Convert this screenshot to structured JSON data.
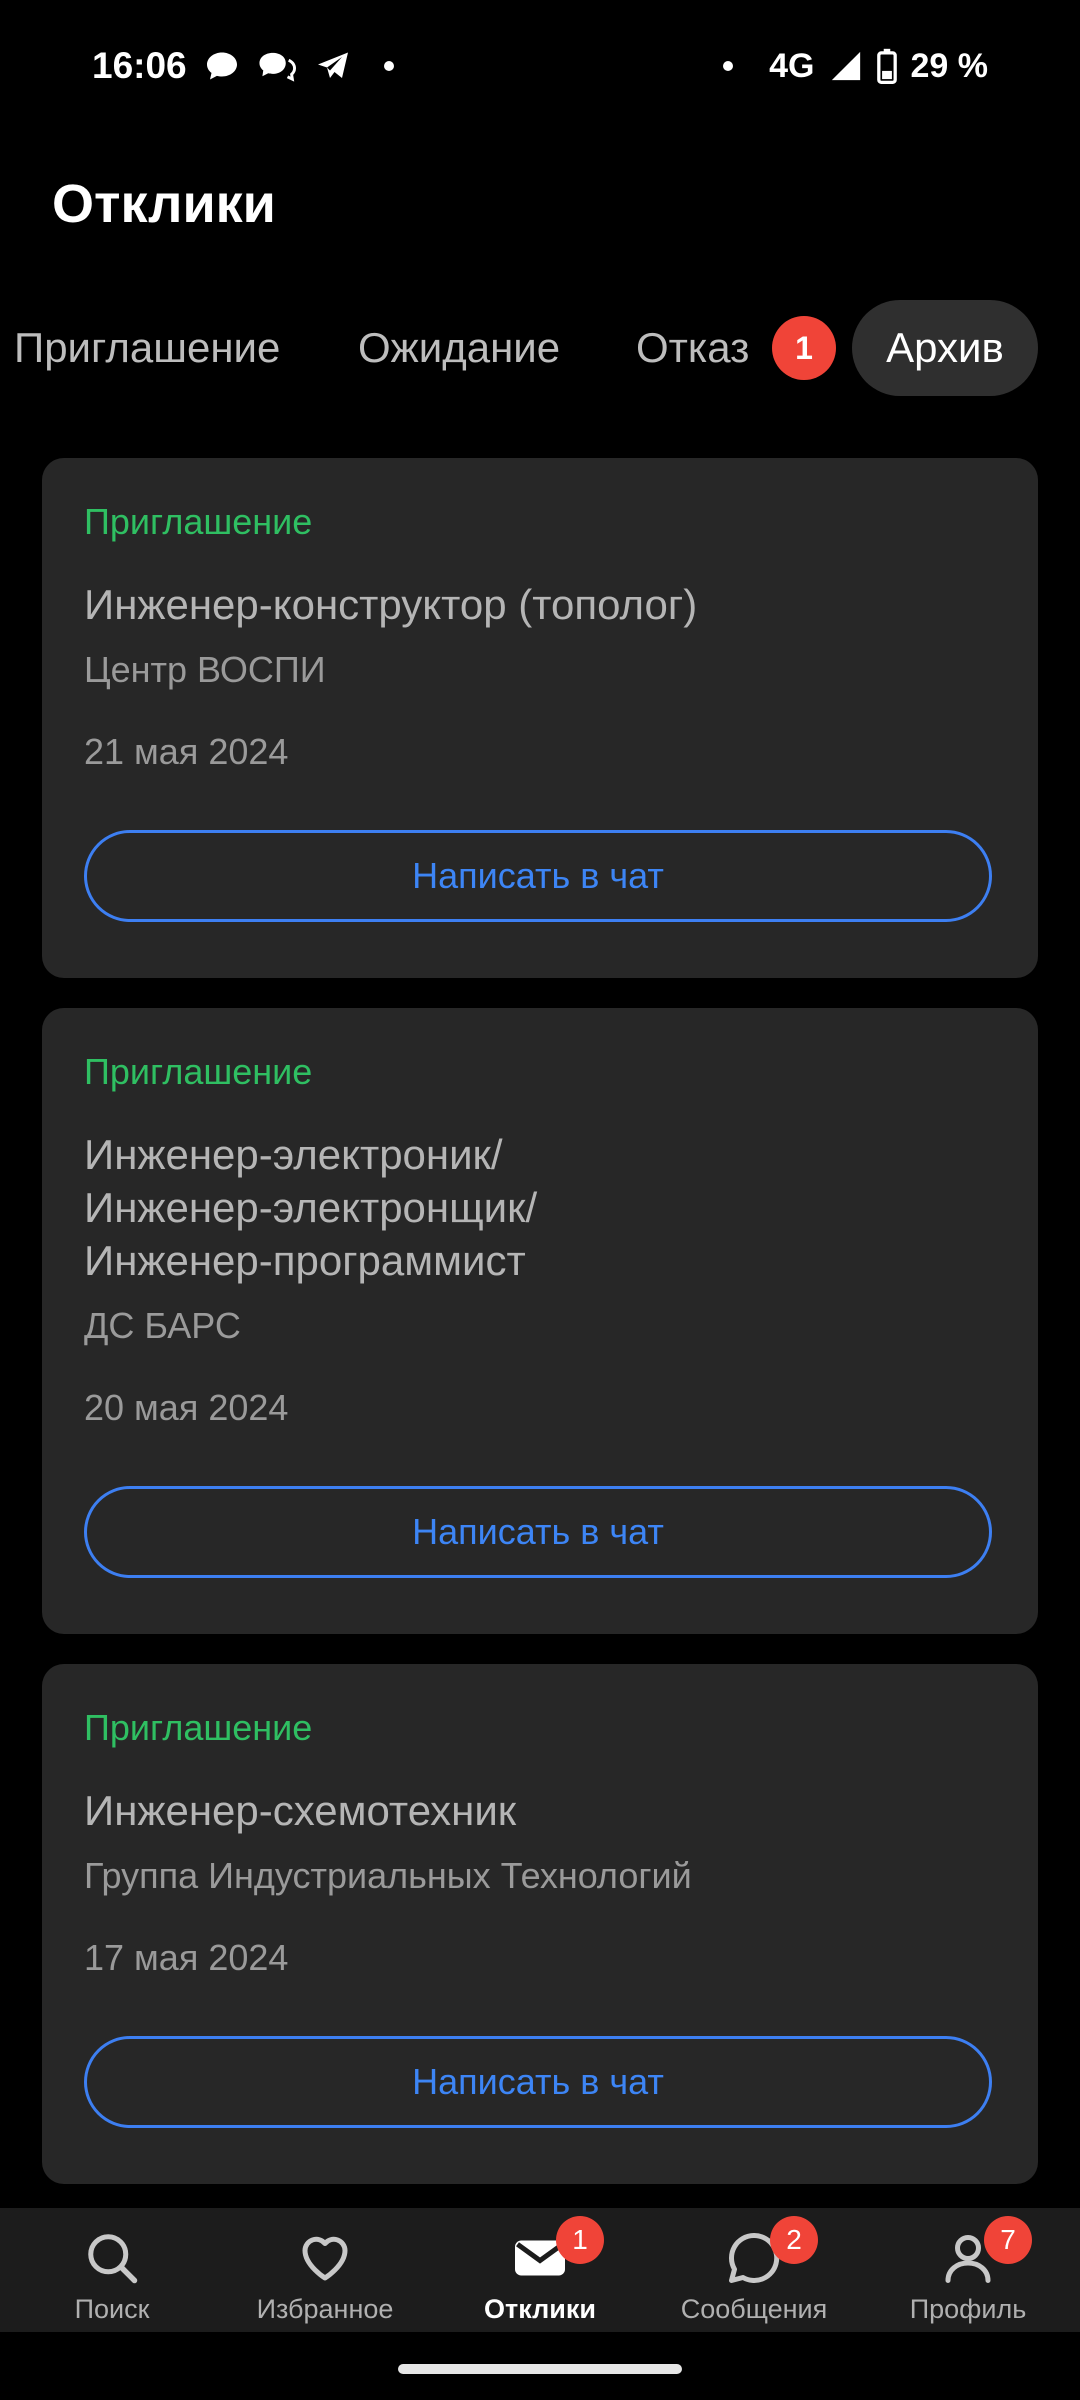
{
  "status_bar": {
    "time": "16:06",
    "network": "4G",
    "battery": "29 %"
  },
  "header": {
    "title": "Отклики"
  },
  "tabs": [
    {
      "label": "Приглашение"
    },
    {
      "label": "Ожидание"
    },
    {
      "label": "Отказ",
      "badge": "1"
    },
    {
      "label": "Архив",
      "selected": true
    }
  ],
  "cards": [
    {
      "status": "Приглашение",
      "title": "Инженер-конструктор (тополог)",
      "company": "Центр ВОСПИ",
      "date": "21 мая 2024",
      "button": "Написать в чат"
    },
    {
      "status": "Приглашение",
      "title": "Инженер-электроник/ Инженер-электронщик/ Инженер-программист",
      "company": "ДС БАРС",
      "date": "20 мая 2024",
      "button": "Написать в чат"
    },
    {
      "status": "Приглашение",
      "title": "Инженер-схемотехник",
      "company": "Группа Индустриальных Технологий",
      "date": "17 мая 2024",
      "button": "Написать в чат"
    }
  ],
  "bottom_nav": [
    {
      "label": "Поиск",
      "icon": "search-icon"
    },
    {
      "label": "Избранное",
      "icon": "heart-icon"
    },
    {
      "label": "Отклики",
      "icon": "mail-icon",
      "badge": "1",
      "active": true
    },
    {
      "label": "Сообщения",
      "icon": "chat-bubble-icon",
      "badge": "2"
    },
    {
      "label": "Профиль",
      "icon": "profile-icon",
      "badge": "7"
    }
  ],
  "colors": {
    "accent_blue": "#3d85f5",
    "status_green": "#2fbf62",
    "badge_red": "#f04438",
    "card_bg": "#272727"
  }
}
